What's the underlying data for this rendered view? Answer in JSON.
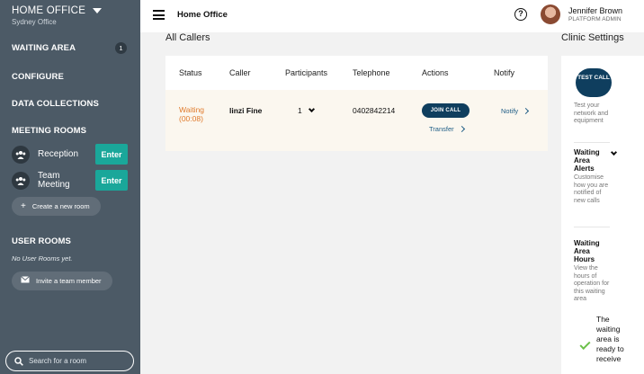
{
  "sidebar": {
    "clinic_name": "HOME OFFICE",
    "clinic_location": "Sydney Office",
    "waiting_area": {
      "label": "WAITING AREA",
      "count": "1"
    },
    "configure": "CONFIGURE",
    "data_collections": "DATA COLLECTIONS",
    "meeting_rooms": {
      "heading": "MEETING ROOMS",
      "rooms": [
        {
          "name": "Reception",
          "enter": "Enter"
        },
        {
          "name": "Team Meeting",
          "enter": "Enter"
        }
      ],
      "create_label": "Create a new room"
    },
    "user_rooms": {
      "heading": "USER ROOMS",
      "empty_text": "No User Rooms yet.",
      "invite_label": "Invite a team member"
    },
    "search": {
      "placeholder": "Search for a room"
    }
  },
  "topbar": {
    "title": "Home Office",
    "help": "?",
    "user_name": "Jennifer Brown",
    "user_role": "PLATFORM ADMIN"
  },
  "callers": {
    "heading": "All Callers",
    "columns": [
      "Status",
      "Caller",
      "Participants",
      "Telephone",
      "Actions",
      "Notify"
    ],
    "rows": [
      {
        "status": "Waiting",
        "wait_time": "(00:08)",
        "caller": "linzi Fine",
        "participants": "1",
        "telephone": "0402842214",
        "join_label": "JOIN CALL",
        "transfer_label": "Transfer",
        "notify_label": "Notify"
      }
    ]
  },
  "settings": {
    "heading": "Clinic Settings",
    "test_call": "TEST CALL",
    "test_call_desc": "Test your network and equipment",
    "alerts_heading": "Waiting Area Alerts",
    "alerts_desc": "Customise how you are notified of new calls",
    "hours_heading": "Waiting Area Hours",
    "hours_desc": "View the hours of operation for this waiting area",
    "ready_text": "The waiting area is ready to receive"
  },
  "colors": {
    "sidebar_bg": "#4c5a66",
    "accent_teal": "#1aa79a",
    "navy": "#0f3e5e",
    "waiting_orange": "#e07a2b",
    "ok_green": "#6cc04a"
  }
}
